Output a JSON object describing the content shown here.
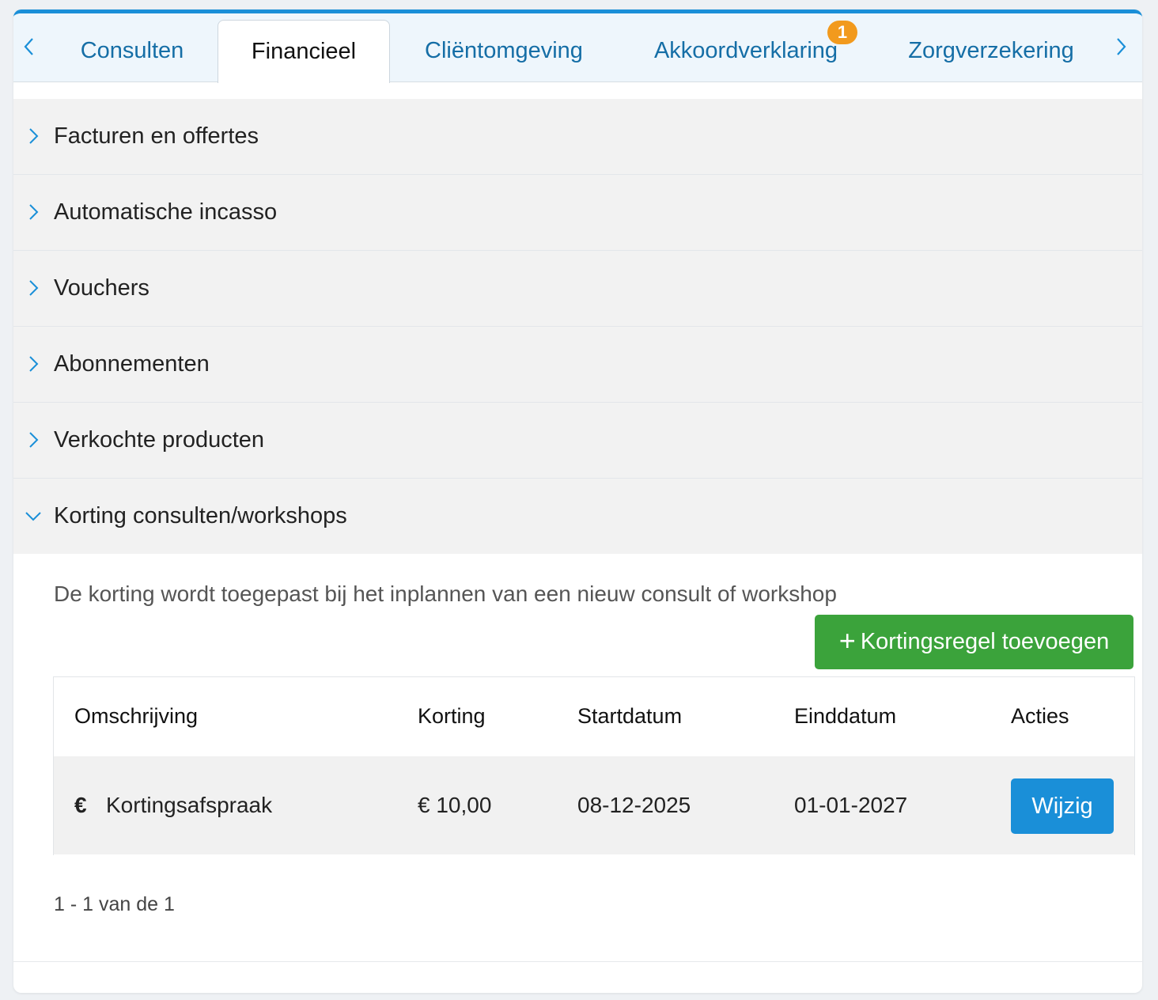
{
  "tabs": {
    "items": [
      {
        "label": "Consulten"
      },
      {
        "label": "Financieel"
      },
      {
        "label": "Cliëntomgeving"
      },
      {
        "label": "Akkoordverklaring",
        "badge": "1"
      },
      {
        "label": "Zorgverzekering"
      }
    ],
    "active": "Financieel",
    "icons": {
      "prev": "chevron-left-icon",
      "next": "chevron-right-icon"
    }
  },
  "sections": [
    {
      "label": "Facturen en offertes",
      "expanded": false
    },
    {
      "label": "Automatische incasso",
      "expanded": false
    },
    {
      "label": "Vouchers",
      "expanded": false
    },
    {
      "label": "Abonnementen",
      "expanded": false
    },
    {
      "label": "Verkochte producten",
      "expanded": false
    },
    {
      "label": "Korting consulten/workshops",
      "expanded": true
    }
  ],
  "discount": {
    "description": "De korting wordt toegepast bij het inplannen van een nieuw consult of workshop",
    "add_button": "Kortingsregel toevoegen",
    "table": {
      "headers": [
        "Omschrijving",
        "Korting",
        "Startdatum",
        "Einddatum",
        "Acties"
      ],
      "rows": [
        {
          "icon": "€",
          "omschrijving": "Kortingsafspraak",
          "korting": "€ 10,00",
          "startdatum": "08-12-2025",
          "einddatum": "01-01-2027",
          "action": "Wijzig"
        }
      ]
    },
    "pagination": "1 - 1 van de 1"
  },
  "colors": {
    "accent": "#1a8fd8",
    "success": "#3ba33b",
    "badge": "#f29a1d"
  }
}
